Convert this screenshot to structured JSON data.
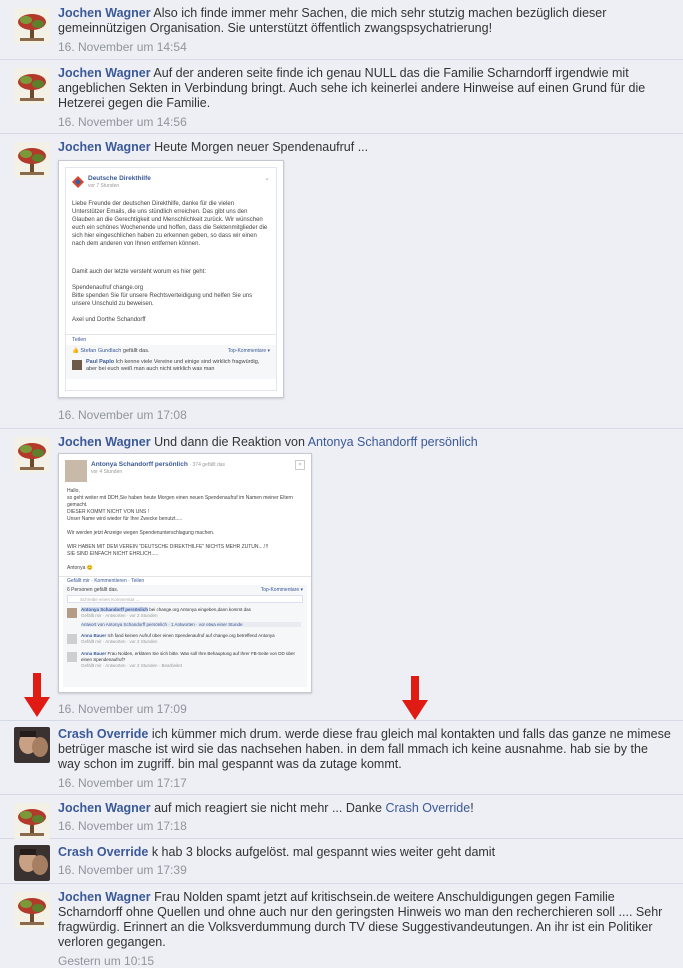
{
  "comments": [
    {
      "author": "Jochen Wagner",
      "text": "Also ich finde immer mehr Sachen, die mich sehr stutzig machen bezüglich dieser gemeinnützigen Organisation. Sie unterstützt öffentlich zwangspsychatrierung!",
      "time": "16. November um 14:54"
    },
    {
      "author": "Jochen Wagner",
      "text": "Auf der anderen seite finde ich genau NULL das die Familie Scharndorff irgendwie mit angeblichen Sekten in Verbindung bringt. Auch sehe ich keinerlei andere Hinweise auf einen Grund für die Hetzerei gegen die Familie.",
      "time": "16. November um 14:56"
    },
    {
      "author": "Jochen Wagner",
      "text": "Heute Morgen neuer Spendenaufruf ...",
      "time": "16. November um 17:08"
    },
    {
      "author": "Jochen Wagner",
      "text_before": "Und dann die Reaktion von ",
      "link": "Antonya Schandorff persönlich",
      "time": "16. November um 17:09"
    },
    {
      "author": "Crash Override",
      "text": "ich kümmer mich drum. werde diese frau gleich mal kontakten und falls das ganze ne mimese betrüger masche ist wird sie das nachsehen haben. in dem fall mmach ich keine ausnahme. hab sie by the way schon im zugriff. bin mal gespannt was da zutage kommt.",
      "time": "16. November um 17:17"
    },
    {
      "author": "Jochen Wagner",
      "text_before": "auf mich reagiert sie nicht mehr ... Danke ",
      "link": "Crash Override",
      "text_after": "!",
      "time": "16. November um 17:18"
    },
    {
      "author": "Crash Override",
      "text": "k hab 3 blocks aufgelöst. mal gespannt wies weiter geht damit",
      "time": "16. November um 17:39"
    },
    {
      "author": "Jochen Wagner",
      "text": "Frau Nolden spamt jetzt auf kritischsein.de weitere Anschuldigungen gegen Familie Scharndorff ohne Quellen und ohne auch nur den geringsten Hinweis wo man den recherchieren soll .... Sehr fragwürdig. Erinnert an die Volksverdummung durch TV diese Suggestivandeutungen. An ihr ist ein Politiker verloren gegangen.",
      "time": "Gestern um 10:15"
    }
  ],
  "shot1": {
    "page": "Deutsche Direkthilfe",
    "sub": "vor 7 Stunden",
    "p1": "Liebe Freunde der deutschen Direkthilfe, danke für die vielen Unterstützer Emails, die uns stündlich erreichen. Das gibt uns den Glauben an die Gerechtigkeit und Menschlichkeit zurück. Wir wünschen euch ein schönes Wochenende und hoffen, dass die Sektenmitglieder die sich hier eingeschlichen haben zu erkennen geben, so dass wir einen nach dem anderen von Ihnen entfernen können.",
    "p2": "Damit auch der letzte versteht worum es hier geht:",
    "p3": "Spendenaufruf change.org",
    "p4": "Bitte spenden Sie für unsere Rechtsverteidigung und helfen Sie uns unsere Unschuld zu beweisen.",
    "p5": "Axel und Dorthe Schandorff",
    "share": "Teilen",
    "likes_name": "Stefan Gundlach",
    "likes_suffix": " gefällt das.",
    "top": "Top-Kommentare ▾",
    "c_name": "Paul Paplo",
    "c_text": "Ich kenne viele Vereine und einige sind wirklich fragwürdig, aber bei euch weiß man auch nicht wirklich was man"
  },
  "shot2": {
    "page": "Antonya Schandorff persönlich",
    "meta": "· 374 gefällt das",
    "sub": "vor 4 Stunden",
    "l1": "Hallo,",
    "l2": "so geht weiter mit DDH,Sie haben heute Morgen einen neuen Spendenaufruf im Namen meiner Eltern gemacht.",
    "l3": "DIESER KOMMT NICHT VON UNS !",
    "l4": "Unser Name wird wieder für Ihre Zwecke benutzt.....",
    "l5": "Wir werden jetzt Anzeige wegen Spendenunterschlagung machen.",
    "l6": "WIR HABEN MIT DEM VEREIN \"DEUTSCHE DIREKTHILFE\" NICHTS MEHR ZUTUN....!!!",
    "l7": "SIE SIND EINFACH NICHT EHRLICH.....",
    "l8": "Antonya 😊",
    "actions": "Gefällt mir · Kommentieren · Teilen",
    "likes": "6 Personen gefällt das.",
    "top": "Top-Kommentare ▾",
    "placeholder": "Schreibe einen Kommentar ...",
    "r1_name": "Antonya Schandorff persönlich",
    "r1_text": "bei change.org Antonya eingeben,dann kommt das",
    "r1_meta": "Gefällt mir · Antworten · vor 2 Stunden",
    "r1_reply": "Antwort von Antonya Schandorff persönlich · 1 Antworten · vor etwa einer Stunde",
    "r2_name": "Anna Bauer",
    "r2_text": "Ich fand keinen Aufruf über einen Spendenaufruf auf change.org betreffend Antonya",
    "r2_meta": "Gefällt mir · Antworten · vor 2 Stunden",
    "r3_name": "Anna Bauer",
    "r3_text": "Frau Nolden, erklären Sie sich bitte. Was soll Ihre Behauptung auf Ihrer FB-Seite von DD über einen Spendenaufruf?",
    "r3_meta": "Gefällt mir · Antworten · vor 2 Stunden · Bearbeitet"
  },
  "colors": {
    "link": "#3b5998",
    "arrow": "#e01b14",
    "timestamp": "#90949c",
    "background": "#edeff4"
  }
}
